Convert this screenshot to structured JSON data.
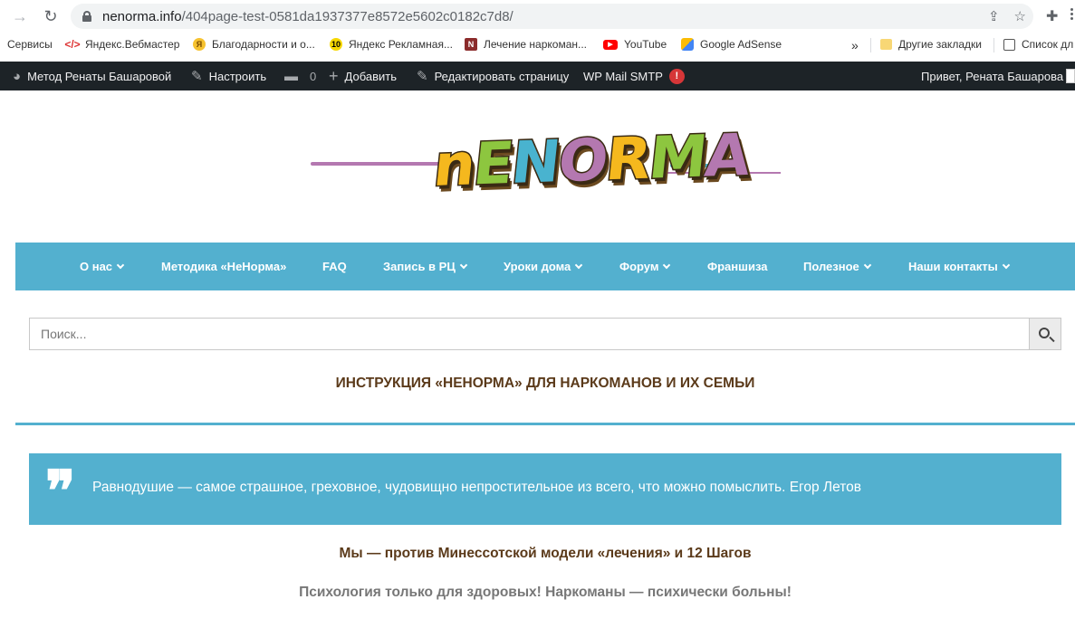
{
  "browser": {
    "url_host": "nenorma.info",
    "url_path": "/404page-test-0581da1937377e8572e5602c0182c7d8/",
    "bookmarks": [
      {
        "label": "Сервисы",
        "icon": "apps-grid-icon"
      },
      {
        "label": "Яндекс.Вебмастер",
        "icon": "code-icon"
      },
      {
        "label": "Благодарности и о...",
        "icon": "yandex-icon"
      },
      {
        "label": "Яндекс Рекламная...",
        "icon": "yandex-badge-icon",
        "badge": "10"
      },
      {
        "label": "Лечение наркоман...",
        "icon": "site-icon"
      },
      {
        "label": "YouTube",
        "icon": "youtube-icon"
      },
      {
        "label": "Google AdSense",
        "icon": "adsense-icon"
      }
    ],
    "overflow": "»",
    "other_bookmarks": "Другие закладки",
    "reading_list": "Список дл"
  },
  "adminbar": {
    "site": "Метод Ренаты Башаровой",
    "customize": "Настроить",
    "comments_count": "0",
    "add_new": "Добавить",
    "edit_page": "Редактировать страницу",
    "smtp": "WP Mail SMTP",
    "smtp_badge": "!",
    "greeting": "Привет, Рената Башарова"
  },
  "logo": {
    "text": "nENORMA"
  },
  "menu": [
    {
      "label": "О нас",
      "dropdown": true
    },
    {
      "label": "Методика «НеНорма»",
      "dropdown": false
    },
    {
      "label": "FAQ",
      "dropdown": false
    },
    {
      "label": "Запись в РЦ",
      "dropdown": true
    },
    {
      "label": "Уроки дома",
      "dropdown": true
    },
    {
      "label": "Форум",
      "dropdown": true
    },
    {
      "label": "Франшиза",
      "dropdown": false
    },
    {
      "label": "Полезное",
      "dropdown": true
    },
    {
      "label": "Наши контакты",
      "dropdown": true
    }
  ],
  "search": {
    "placeholder": "Поиск..."
  },
  "content": {
    "heading": "ИНСТРУКЦИЯ «НЕНОРМА» ДЛЯ НАРКОМАНОВ И ИХ СЕМЬИ",
    "quote_mark": "❞",
    "quote": "Равнодушие — самое страшное, греховное, чудовищно непростительное из всего, что можно помыслить. Егор Летов",
    "line1": "Мы — против Минессотской модели «лечения» и 12 Шагов",
    "line2": "Психология только для здоровых! Наркоманы — психически больны!"
  },
  "colors": {
    "accent": "#53b0cf",
    "heading": "#5b3a1a",
    "adminbar": "#1d2327"
  }
}
